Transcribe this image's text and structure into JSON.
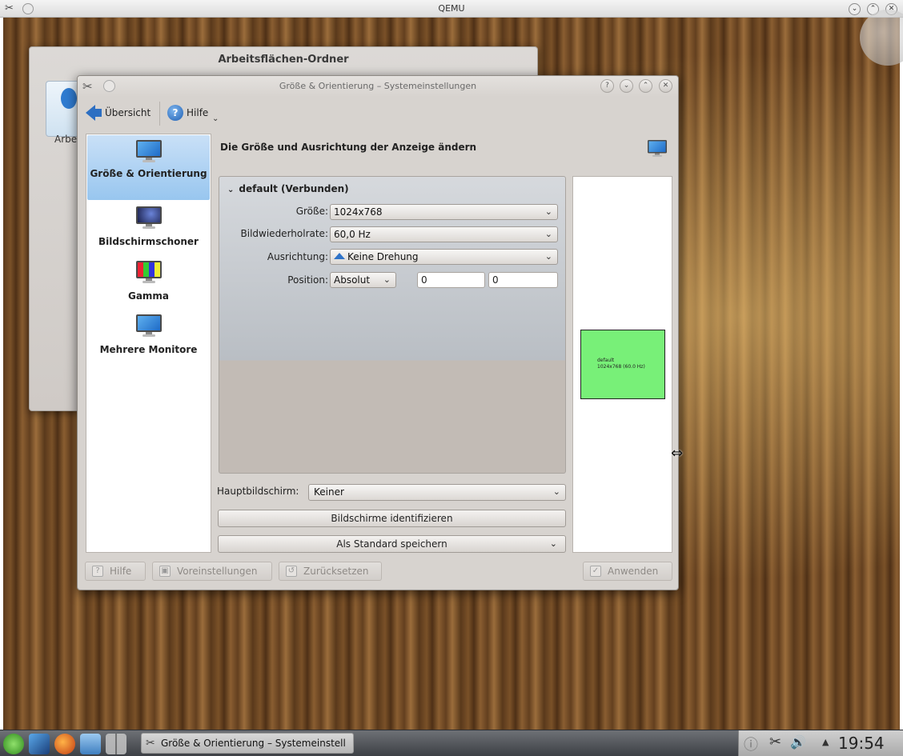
{
  "qemu": {
    "title": "QEMU"
  },
  "bg_window": {
    "title": "Arbeitsflächen-Ordner",
    "icon_label": "Arbe"
  },
  "main_window": {
    "title": "Größe & Orientierung – Systemeinstellungen",
    "toolbar": {
      "overview": "Übersicht",
      "help": "Hilfe"
    },
    "categories": [
      {
        "label": "Größe & Orientierung",
        "icon": "monitor-icon",
        "selected": true
      },
      {
        "label": "Bildschirmschoner",
        "icon": "screensaver-icon",
        "selected": false
      },
      {
        "label": "Gamma",
        "icon": "gamma-icon",
        "selected": false
      },
      {
        "label": "Mehrere Monitore",
        "icon": "monitor-icon",
        "selected": false
      }
    ],
    "heading": "Die Größe und Ausrichtung der Anzeige ändern",
    "output": {
      "title": "default (Verbunden)",
      "size_label": "Größe:",
      "size_value": "1024x768",
      "refresh_label": "Bildwiederholrate:",
      "refresh_value": "60,0 Hz",
      "orientation_label": "Ausrichtung:",
      "orientation_value": "Keine Drehung",
      "position_label": "Position:",
      "position_mode": "Absolut",
      "pos_x": "0",
      "pos_y": "0"
    },
    "preview": {
      "name": "default",
      "mode": "1024x768 (60.0 Hz)",
      "color": "#78f078"
    },
    "primary_label": "Hauptbildschirm:",
    "primary_value": "Keiner",
    "identify_button": "Bildschirme identifizieren",
    "save_default_button": "Als Standard speichern",
    "bottom": {
      "help": "Hilfe",
      "defaults": "Voreinstellungen",
      "reset": "Zurücksetzen",
      "apply": "Anwenden"
    }
  },
  "taskbar": {
    "task_label": "Größe & Orientierung – Systemeinstell",
    "clock": "19:54"
  }
}
